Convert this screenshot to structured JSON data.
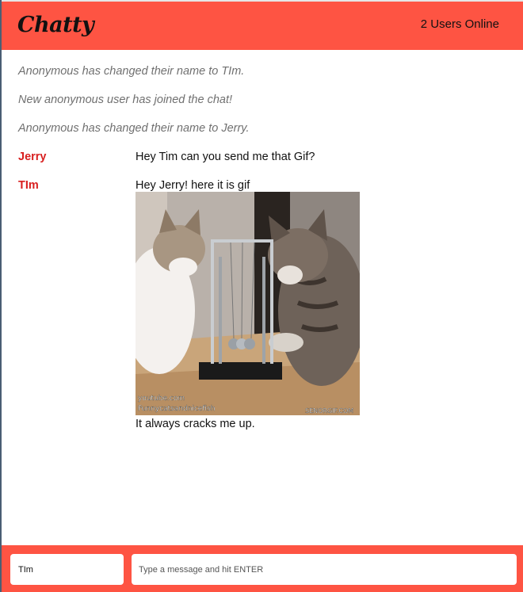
{
  "navbar": {
    "brand": "Chatty",
    "users_online": "2 Users Online"
  },
  "messages": {
    "system": [
      "Anonymous has changed their name to TIm.",
      "New anonymous user has joined the chat!",
      "Anonymous has changed their name to Jerry."
    ],
    "chat": [
      {
        "username": "Jerry",
        "content": "Hey Tim can you send me that Gif?"
      },
      {
        "username": "TIm",
        "content": "Hey Jerry! here it is gif"
      }
    ],
    "gif": {
      "description": "Two kittens playing with a Newton's cradle",
      "watermark_left_1": "youtube.com",
      "watermark_left_2": "Funnycatsandnicefish",
      "watermark_right": "SENORGIF.COM",
      "caption": "It always cracks me up."
    }
  },
  "chatbar": {
    "username_value": "TIm",
    "message_placeholder": "Type a message and hit ENTER"
  },
  "colors": {
    "accent": "#fe5443",
    "username": "#d81f1f",
    "system_text": "#707070"
  }
}
